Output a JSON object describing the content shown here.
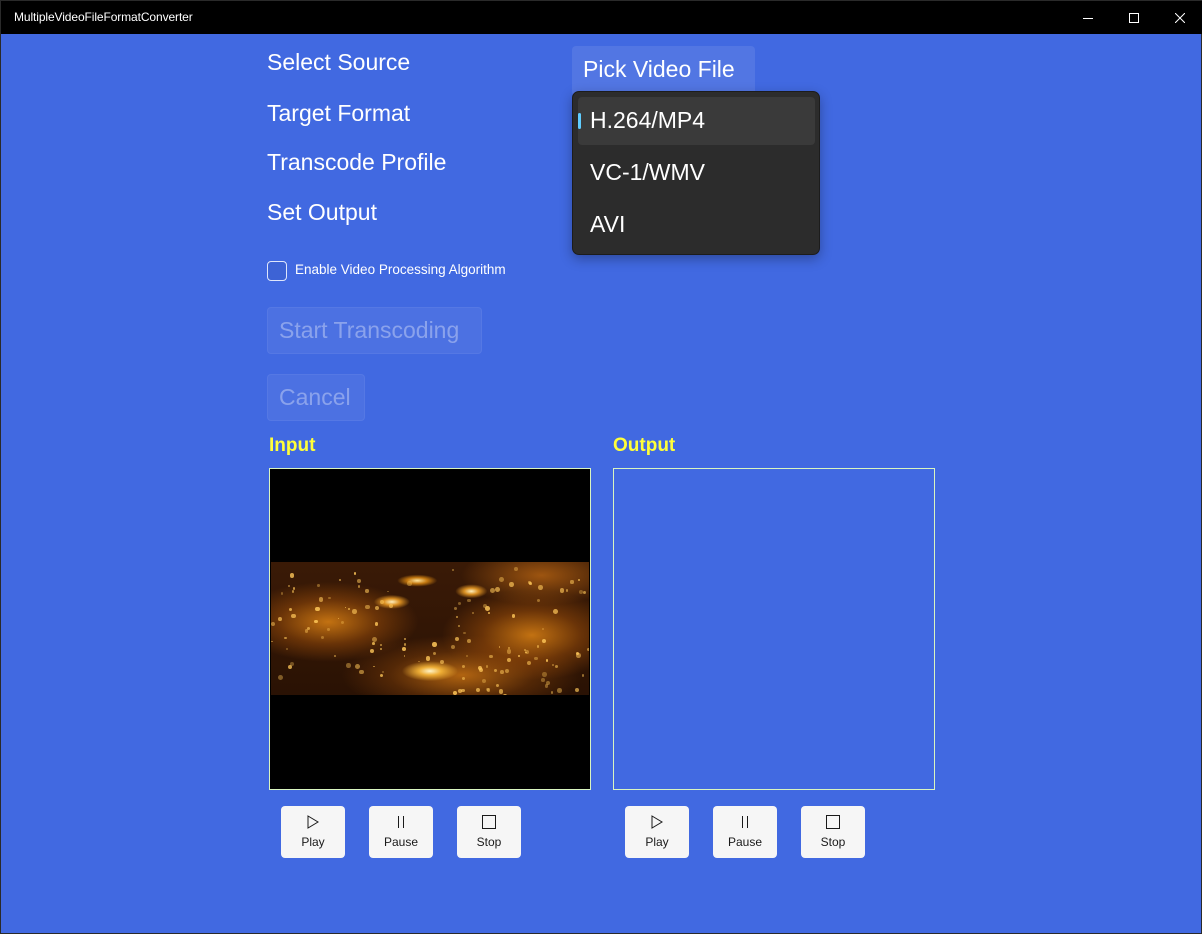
{
  "window": {
    "title": "MultipleVideoFileFormatConverter",
    "controls": [
      "minimize",
      "maximize",
      "close"
    ]
  },
  "labels": {
    "select_source": "Select Source",
    "target_format": "Target Format",
    "transcode_profile": "Transcode Profile",
    "set_output": "Set Output"
  },
  "pick_button": {
    "label": "Pick Video File"
  },
  "format_dropdown": {
    "options": [
      "H.264/MP4",
      "VC-1/WMV",
      "AVI"
    ],
    "selected": "H.264/MP4"
  },
  "checkbox": {
    "label": "Enable Video Processing Algorithm",
    "checked": false
  },
  "buttons": {
    "start": "Start Transcoding",
    "cancel": "Cancel"
  },
  "input_panel": {
    "title": "Input",
    "controls": {
      "play": "Play",
      "pause": "Pause",
      "stop": "Stop"
    }
  },
  "output_panel": {
    "title": "Output",
    "controls": {
      "play": "Play",
      "pause": "Pause",
      "stop": "Stop"
    }
  },
  "colors": {
    "background": "#4169E1",
    "section_title": "#FFFF3A",
    "dropdown_bg": "#2C2C2C",
    "selection_indicator": "#60CDFF"
  }
}
